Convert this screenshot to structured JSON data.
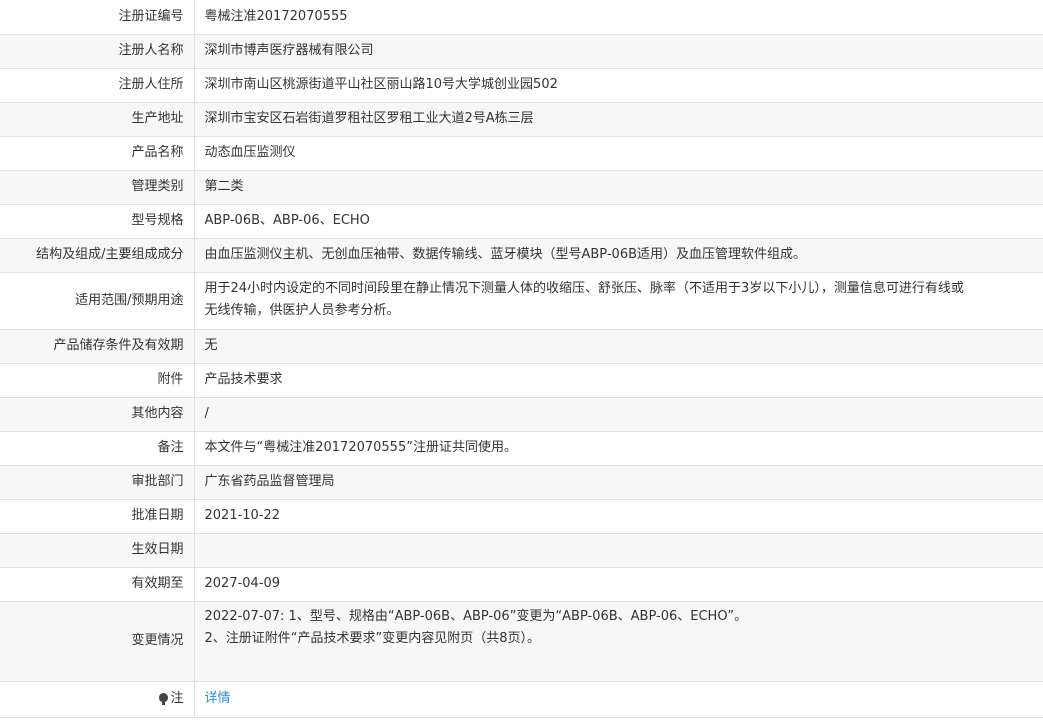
{
  "rows": [
    {
      "label": "注册证编号",
      "value": "粤械注准20172070555"
    },
    {
      "label": "注册人名称",
      "value": "深圳市博声医疗器械有限公司"
    },
    {
      "label": "注册人住所",
      "value": "深圳市南山区桃源街道平山社区丽山路10号大学城创业园502"
    },
    {
      "label": "生产地址",
      "value": "深圳市宝安区石岩街道罗租社区罗租工业大道2号A栋三层"
    },
    {
      "label": "产品名称",
      "value": "动态血压监测仪"
    },
    {
      "label": "管理类别",
      "value": "第二类"
    },
    {
      "label": "型号规格",
      "value": "ABP-06B、ABP-06、ECHO"
    },
    {
      "label": "结构及组成/主要组成成分",
      "value": "由血压监测仪主机、无创血压袖带、数据传输线、蓝牙模块（型号ABP-06B适用）及血压管理软件组成。"
    },
    {
      "label": "适用范围/预期用途",
      "value_lines": [
        "用于24小时内设定的不同时间段里在静止情况下测量人体的收缩压、舒张压、脉率（不适用于3岁以下小儿），测量信息可进行有线或",
        "无线传输，供医护人员参考分析。"
      ]
    },
    {
      "label": "产品储存条件及有效期",
      "value": "无"
    },
    {
      "label": "附件",
      "value": "产品技术要求"
    },
    {
      "label": "其他内容",
      "value": "/"
    },
    {
      "label": "备注",
      "value": "本文件与“粤械注准20172070555”注册证共同使用。"
    },
    {
      "label": "审批部门",
      "value": "广东省药品监督管理局"
    },
    {
      "label": "批准日期",
      "value": "2021-10-22"
    },
    {
      "label": "生效日期",
      "value": ""
    },
    {
      "label": "有效期至",
      "value": "2027-04-09"
    },
    {
      "label": "变更情况",
      "value_lines": [
        "2022-07-07: 1、型号、规格由“ABP-06B、ABP-06”变更为“ABP-06B、ABP-06、ECHO”。",
        "2、注册证附件“产品技术要求”变更内容见附页（共8页）。"
      ]
    }
  ],
  "note": {
    "label": "注",
    "icon": "lightbulb-icon",
    "link_text": "详情",
    "link_color": "#2f8fd8"
  }
}
